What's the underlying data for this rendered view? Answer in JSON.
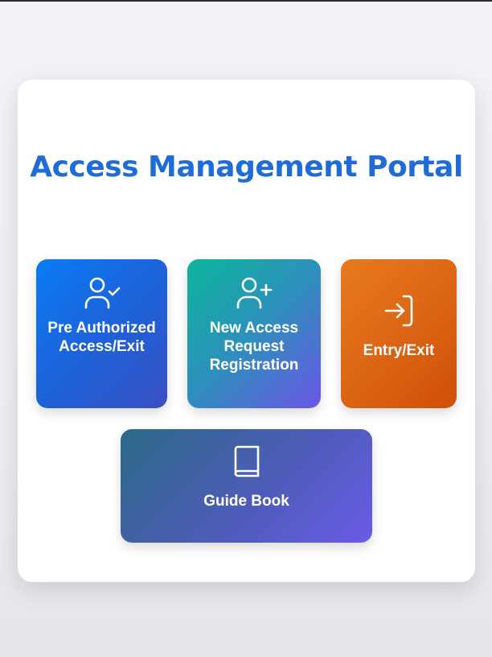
{
  "portal": {
    "title": "Access Management Portal"
  },
  "tiles": [
    {
      "label": "Pre Authorized Access/Exit",
      "icon": "user-check-icon",
      "gradient": [
        "#0a7cf5",
        "#3a4fc3"
      ]
    },
    {
      "label": "New Access Request Registration",
      "icon": "user-plus-icon",
      "gradient": [
        "#0bb69a",
        "#6a56e6"
      ]
    },
    {
      "label": "Entry/Exit",
      "icon": "sign-in-icon",
      "gradient": [
        "#e87a1e",
        "#cf4f06"
      ]
    },
    {
      "label": "Guide Book",
      "icon": "book-icon",
      "gradient": [
        "#2c6a87",
        "#6a5be6"
      ]
    }
  ],
  "colors": {
    "title": "#1f6cd9",
    "card_background": "#ffffff",
    "page_background": "#eef0f3"
  }
}
